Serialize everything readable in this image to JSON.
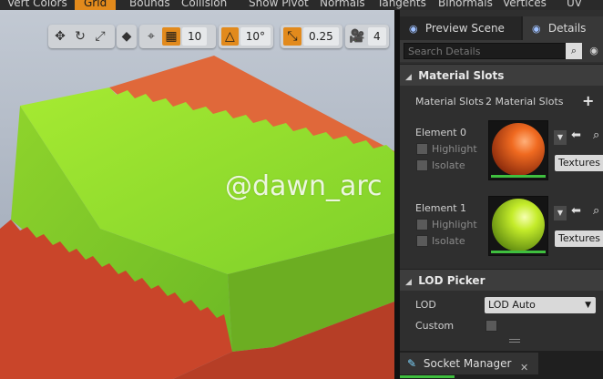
{
  "show_flags": [
    {
      "label": "Vert Colors",
      "active": false
    },
    {
      "label": "Grid",
      "active": true
    },
    {
      "label": "Bounds",
      "active": false
    },
    {
      "label": "Collision",
      "active": false
    },
    {
      "label": "Show Pivot",
      "active": false
    },
    {
      "label": "Normals",
      "active": false
    },
    {
      "label": "Tangents",
      "active": false
    },
    {
      "label": "Binormals",
      "active": false
    },
    {
      "label": "Vertices",
      "active": false
    },
    {
      "label": "UV",
      "active": false
    }
  ],
  "viewport_toolbar": {
    "grid_snap_value": "10",
    "rotation_snap_value": "10°",
    "scale_snap_value": "0.25",
    "camera_speed_value": "4"
  },
  "watermark": "@dawn_arc",
  "tabs": {
    "preview_scene": "Preview Scene",
    "details": "Details"
  },
  "search": {
    "placeholder": "Search Details"
  },
  "material_slots": {
    "header": "Material Slots",
    "label": "Material Slots",
    "count_text": "2 Material Slots",
    "elements": [
      {
        "name": "Element 0",
        "highlight": "Highlight",
        "isolate": "Isolate",
        "textures": "Textures",
        "color": "#e8641a"
      },
      {
        "name": "Element 1",
        "highlight": "Highlight",
        "isolate": "Isolate",
        "textures": "Textures",
        "color": "#c7ec2c"
      }
    ]
  },
  "lod_picker": {
    "header": "LOD Picker",
    "lod_label": "LOD",
    "lod_value": "LOD Auto",
    "custom_label": "Custom"
  },
  "socket_manager": {
    "label": "Socket Manager"
  },
  "colors": {
    "accent": "#e28a1c",
    "cube_top": "#8ad62a",
    "cube_side": "#c9452a"
  }
}
